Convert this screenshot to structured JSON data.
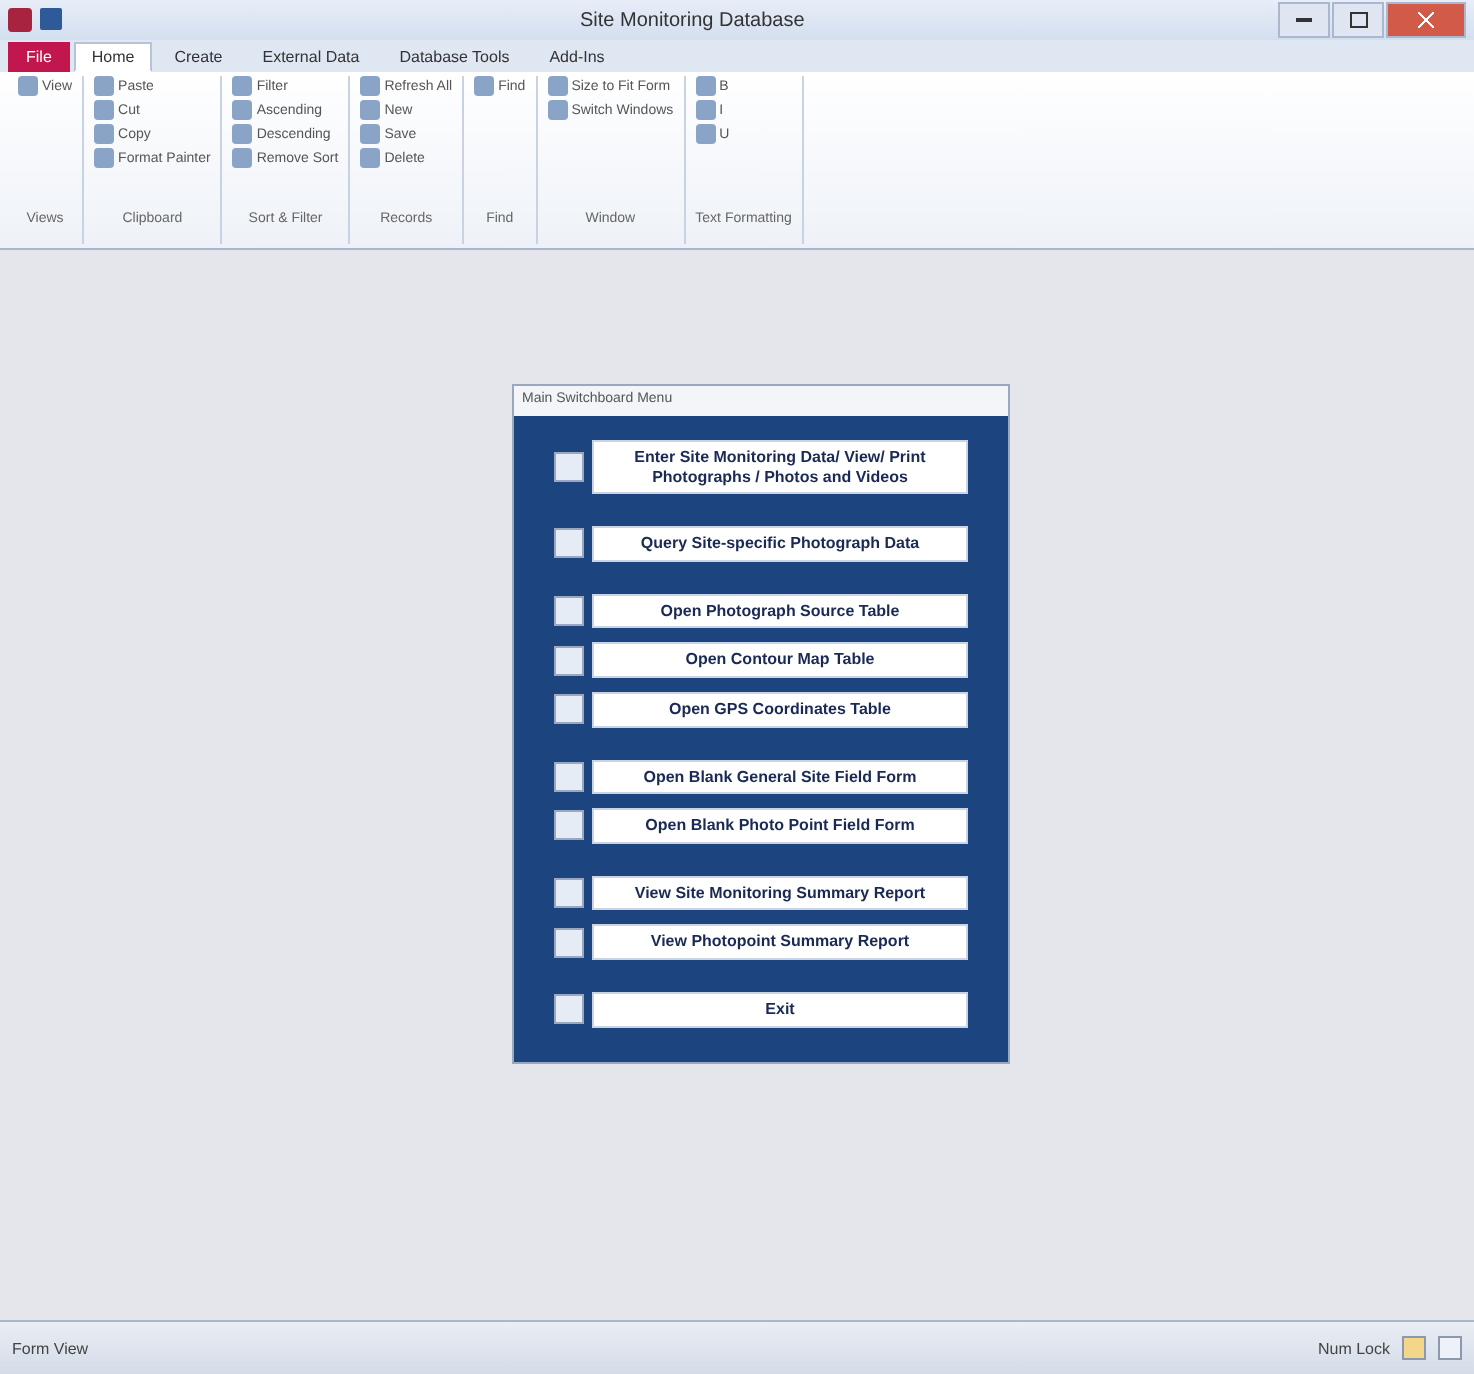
{
  "window": {
    "title": "Site Monitoring Database"
  },
  "tabs": [
    {
      "label": "File",
      "selected": false,
      "kind": "file"
    },
    {
      "label": "Home",
      "selected": true,
      "kind": "tab"
    },
    {
      "label": "Create",
      "selected": false,
      "kind": "tab"
    },
    {
      "label": "External Data",
      "selected": false,
      "kind": "tab"
    },
    {
      "label": "Database Tools",
      "selected": false,
      "kind": "tab"
    },
    {
      "label": "Add-Ins",
      "selected": false,
      "kind": "tab"
    }
  ],
  "ribbon_groups": [
    {
      "label": "Views",
      "items": [
        "View"
      ]
    },
    {
      "label": "Clipboard",
      "items": [
        "Paste",
        "Cut",
        "Copy",
        "Format Painter"
      ]
    },
    {
      "label": "Sort & Filter",
      "items": [
        "Filter",
        "Ascending",
        "Descending",
        "Remove Sort"
      ]
    },
    {
      "label": "Records",
      "items": [
        "Refresh All",
        "New",
        "Save",
        "Delete"
      ]
    },
    {
      "label": "Find",
      "items": [
        "Find"
      ]
    },
    {
      "label": "Window",
      "items": [
        "Size to Fit Form",
        "Switch Windows"
      ]
    },
    {
      "label": "Text Formatting",
      "items": [
        "B",
        "I",
        "U"
      ]
    }
  ],
  "form": {
    "title": "Main Switchboard Menu",
    "groups": [
      {
        "buttons": [
          {
            "label": "Enter Site Monitoring Data/ View/ Print Photographs / Photos and Videos",
            "checked": false
          }
        ]
      },
      {
        "buttons": [
          {
            "label": "Query Site-specific Photograph Data",
            "checked": false
          }
        ]
      },
      {
        "buttons": [
          {
            "label": "Open Photograph Source Table",
            "checked": false
          },
          {
            "label": "Open Contour Map Table",
            "checked": false
          },
          {
            "label": "Open GPS Coordinates Table",
            "checked": false
          }
        ]
      },
      {
        "buttons": [
          {
            "label": "Open Blank General Site Field Form",
            "checked": false
          },
          {
            "label": "Open Blank Photo Point Field Form",
            "checked": false
          }
        ]
      },
      {
        "buttons": [
          {
            "label": "View Site Monitoring Summary Report",
            "checked": false
          },
          {
            "label": "View Photopoint Summary Report",
            "checked": false
          }
        ]
      },
      {
        "buttons": [
          {
            "label": "Exit",
            "checked": false
          }
        ]
      }
    ]
  },
  "status_bar": {
    "left": "Form View",
    "right": "Num Lock"
  }
}
